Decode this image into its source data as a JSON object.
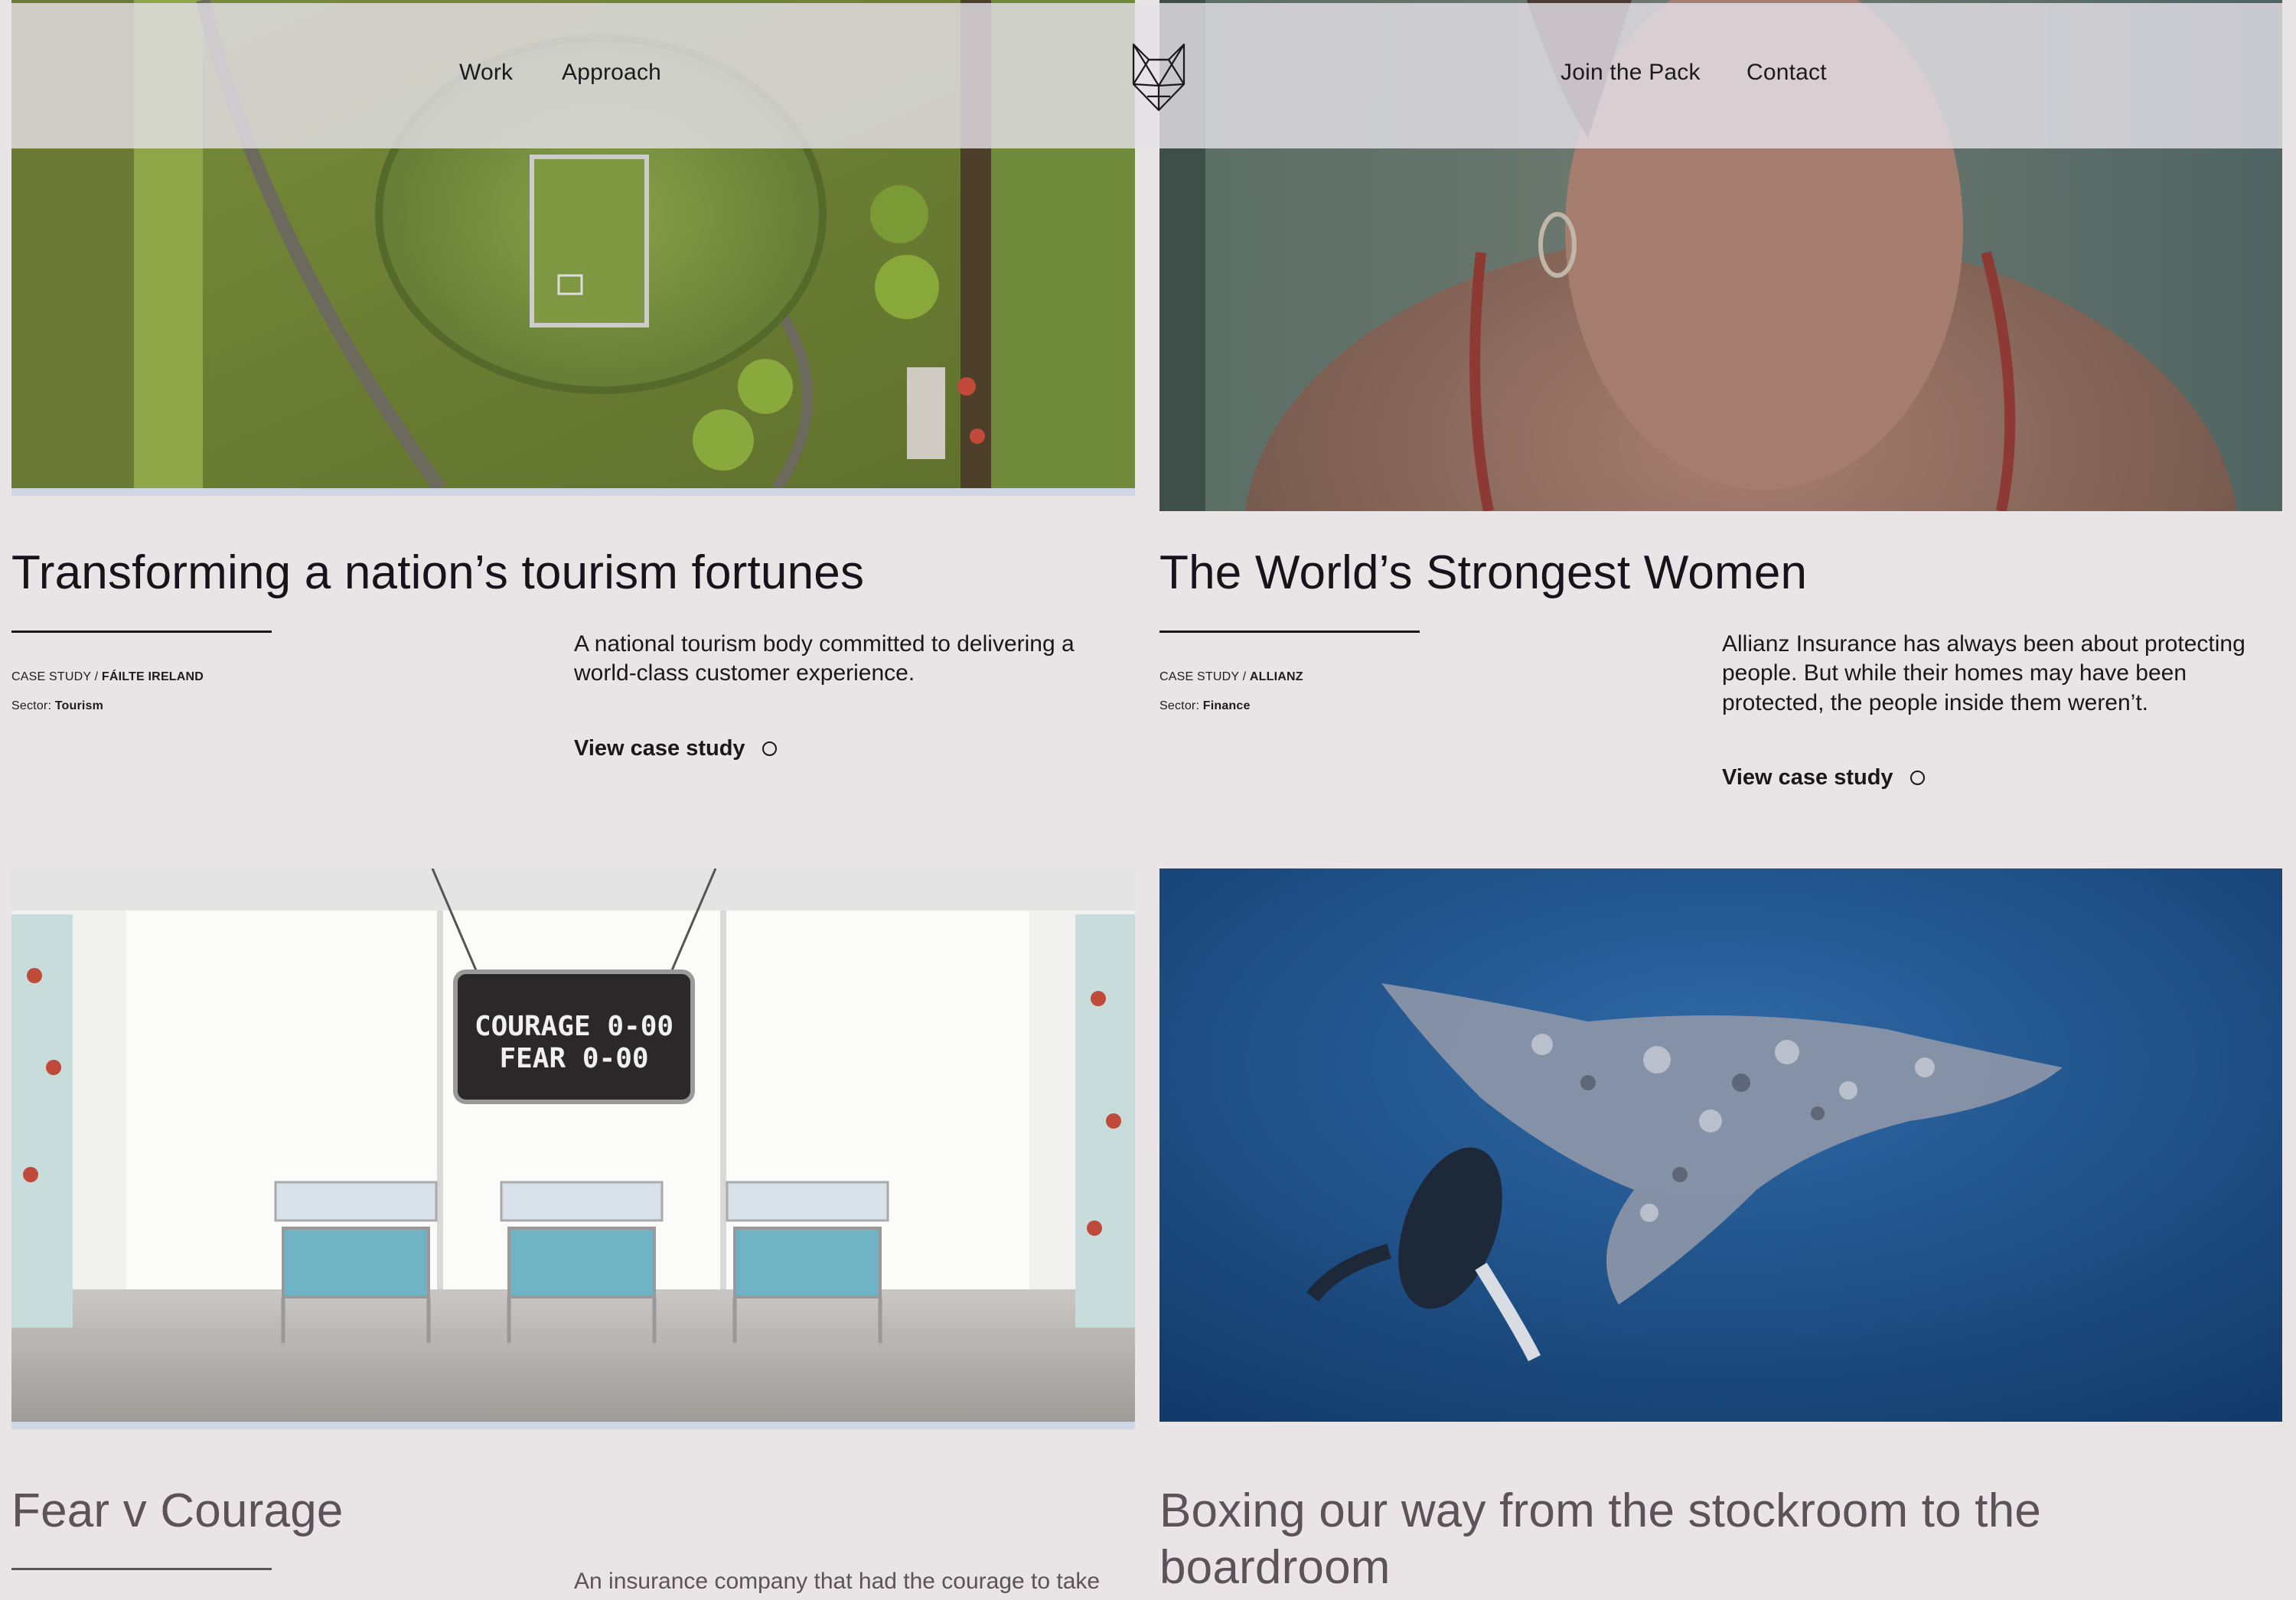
{
  "nav": {
    "left": [
      "Work",
      "Approach"
    ],
    "right": [
      "Join the Pack",
      "Contact"
    ],
    "logo_icon": "wolf-head-icon"
  },
  "cards": [
    {
      "title": "Transforming a nation’s tourism fortunes",
      "case_label": "CASE STUDY / ",
      "client": "FÁILTE IRELAND",
      "sector_label": "Sector: ",
      "sector": "Tourism",
      "description": "A national tourism body committed to delivering a world-class customer experience.",
      "cta": "View case study",
      "image": "aerial-view-of-ancient-mound-photo"
    },
    {
      "title": "The World’s Strongest Women",
      "case_label": "CASE STUDY / ",
      "client": "ALLIANZ",
      "sector_label": "Sector: ",
      "sector": "Finance",
      "description": "Allianz Insurance has always been about protecting people. But while their homes may have been protected, the people inside them weren’t.",
      "cta": "View case study",
      "image": "woman-portrait-photo"
    },
    {
      "title": "Fear v Courage",
      "description": "An insurance company that had the courage to take",
      "image": "hospital-nursery-scoreboard-photo",
      "scoreboard": {
        "line1_team": "COURAGE",
        "line1_score": "0-00",
        "line2_team": "FEAR",
        "line2_score": "0-00"
      }
    },
    {
      "title": "Boxing our way from the stockroom to the boardroom",
      "image": "whale-made-of-plastic-underwater-photo"
    }
  ],
  "colors": {
    "background": "#e9e5e6",
    "header_overlay": "#e4e1e8",
    "text": "#1a1718",
    "ocean": "#1d4f8c"
  }
}
